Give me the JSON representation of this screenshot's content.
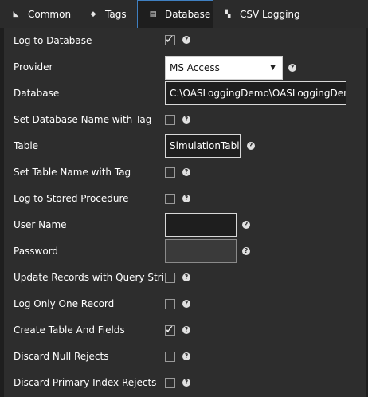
{
  "tabs": [
    {
      "label": "Common",
      "icon": "common-icon",
      "active": false
    },
    {
      "label": "Tags",
      "icon": "tags-icon",
      "active": false
    },
    {
      "label": "Database",
      "icon": "database-icon",
      "active": true
    },
    {
      "label": "CSV Logging",
      "icon": "csv-logging-icon",
      "active": false
    }
  ],
  "form": {
    "log_to_database": {
      "label": "Log to Database",
      "checked": true
    },
    "provider": {
      "label": "Provider",
      "value": "MS Access"
    },
    "database": {
      "label": "Database",
      "value": "C:\\OASLoggingDemo\\OASLoggingDemo"
    },
    "set_database_name_with_tag": {
      "label": "Set Database Name with Tag",
      "checked": false
    },
    "table": {
      "label": "Table",
      "value": "SimulationTable"
    },
    "set_table_name_with_tag": {
      "label": "Set Table Name with Tag",
      "checked": false
    },
    "log_to_stored_procedure": {
      "label": "Log to Stored Procedure",
      "checked": false
    },
    "user_name": {
      "label": "User Name",
      "value": ""
    },
    "password": {
      "label": "Password",
      "value": ""
    },
    "update_records_with_query_string": {
      "label": "Update Records with Query String",
      "checked": false
    },
    "log_only_one_record": {
      "label": "Log Only One Record",
      "checked": false
    },
    "create_table_and_fields": {
      "label": "Create Table And Fields",
      "checked": true
    },
    "discard_null_rejects": {
      "label": "Discard Null Rejects",
      "checked": false
    },
    "discard_primary_index_rejects": {
      "label": "Discard Primary Index Rejects",
      "checked": false
    }
  },
  "help_glyph": "?",
  "check_glyph": "✓",
  "caret_glyph": "▼",
  "colors": {
    "accent": "#3f7fc0",
    "panel": "#2d2d2d",
    "background": "#1e1e1e"
  }
}
